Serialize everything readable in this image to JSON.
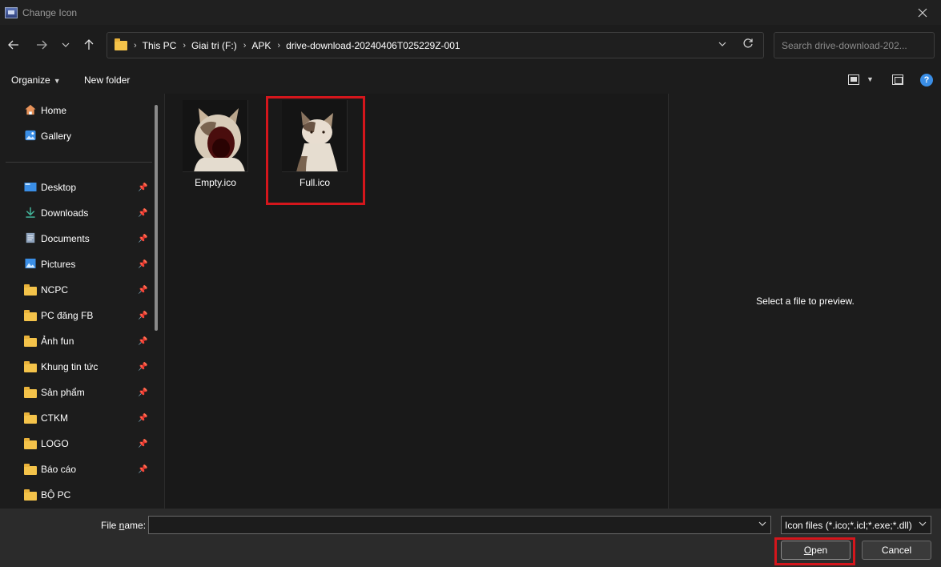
{
  "window": {
    "title": "Change Icon"
  },
  "navigation": {
    "breadcrumbs": [
      "This PC",
      "Giai tri (F:)",
      "APK",
      "drive-download-20240406T025229Z-001"
    ],
    "search_placeholder": "Search drive-download-202..."
  },
  "commandbar": {
    "organize": "Organize",
    "new_folder": "New folder"
  },
  "sidebar": {
    "top": [
      {
        "label": "Home",
        "icon": "home-icon"
      },
      {
        "label": "Gallery",
        "icon": "gallery-icon"
      }
    ],
    "quick": [
      {
        "label": "Desktop",
        "icon": "desktop-icon",
        "pinned": true
      },
      {
        "label": "Downloads",
        "icon": "downloads-icon",
        "pinned": true
      },
      {
        "label": "Documents",
        "icon": "documents-icon",
        "pinned": true
      },
      {
        "label": "Pictures",
        "icon": "pictures-icon",
        "pinned": true
      },
      {
        "label": "NCPC",
        "icon": "folder-icon",
        "pinned": true
      },
      {
        "label": "PC đăng FB",
        "icon": "folder-icon",
        "pinned": true
      },
      {
        "label": "Ảnh fun",
        "icon": "folder-icon",
        "pinned": true
      },
      {
        "label": "Khung tin tức",
        "icon": "folder-icon",
        "pinned": true
      },
      {
        "label": "Sản phẩm",
        "icon": "folder-icon",
        "pinned": true
      },
      {
        "label": "CTKM",
        "icon": "folder-icon",
        "pinned": true
      },
      {
        "label": "LOGO",
        "icon": "folder-icon",
        "pinned": true
      },
      {
        "label": "Báo cáo",
        "icon": "folder-icon",
        "pinned": true
      },
      {
        "label": "BỘ PC",
        "icon": "folder-icon",
        "pinned": false
      }
    ]
  },
  "files": [
    {
      "name": "Empty.ico",
      "thumb": "cat-mouth-open"
    },
    {
      "name": "Full.ico",
      "thumb": "cat-mouth-closed",
      "highlighted": true
    }
  ],
  "preview": {
    "text": "Select a file to preview."
  },
  "bottom": {
    "filename_label_pre": "File ",
    "filename_label_underlined": "n",
    "filename_label_post": "ame:",
    "filename_value": "",
    "filter_value": "Icon files (*.ico;*.icl;*.exe;*.dll)",
    "open_underlined": "O",
    "open_rest": "pen",
    "cancel_label": "Cancel"
  },
  "colors": {
    "highlight": "#d4161c",
    "folder": "#f4c34a",
    "help": "#3a8ee6"
  }
}
